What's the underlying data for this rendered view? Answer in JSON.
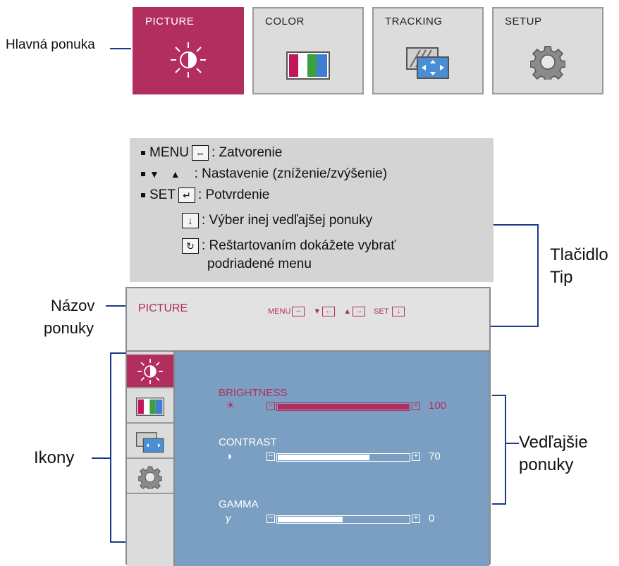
{
  "main_menu": {
    "callout": "Hlavná ponuka",
    "tabs": [
      {
        "label": "PICTURE",
        "icon": "brightness-icon",
        "active": true
      },
      {
        "label": "COLOR",
        "icon": "color-bars-icon",
        "active": false
      },
      {
        "label": "TRACKING",
        "icon": "tracking-icon",
        "active": false
      },
      {
        "label": "SETUP",
        "icon": "gear-icon",
        "active": false
      }
    ]
  },
  "tip_box": {
    "rows": [
      {
        "key": "MENU",
        "text": ": Zatvorenie"
      },
      {
        "key": "▼ ▲",
        "text": ": Nastavenie (zníženie/zvýšenie)"
      },
      {
        "key": "SET",
        "text": ": Potvrdenie"
      },
      {
        "key": "",
        "text": ": Výber inej vedľajšej ponuky"
      },
      {
        "key": "",
        "text": ": Reštartovaním dokážete vybrať"
      },
      {
        "key": "",
        "text": "podriadené menu"
      }
    ]
  },
  "callouts": {
    "tip_button_1": "Tlačidlo",
    "tip_button_2": "Tip",
    "menu_name_1": "Názov",
    "menu_name_2": "ponuky",
    "icons": "Ikony",
    "submenus_1": "Vedľajšie",
    "submenus_2": "ponuky"
  },
  "osd": {
    "title": "PICTURE",
    "keys": {
      "menu": "MENU",
      "set": "SET"
    },
    "items": [
      {
        "label": "BRIGHTNESS",
        "value": "100",
        "level": 1.0,
        "active": true,
        "symbol": "☀"
      },
      {
        "label": "CONTRAST",
        "value": "70",
        "level": 0.7,
        "active": false,
        "symbol": "◑"
      },
      {
        "label": "GAMMA",
        "value": "0",
        "level": 0.5,
        "active": false,
        "symbol": "γ"
      }
    ]
  },
  "colors": {
    "accent": "#b22e5e",
    "panel": "#7a9fc2",
    "line": "#1a3a8a"
  }
}
